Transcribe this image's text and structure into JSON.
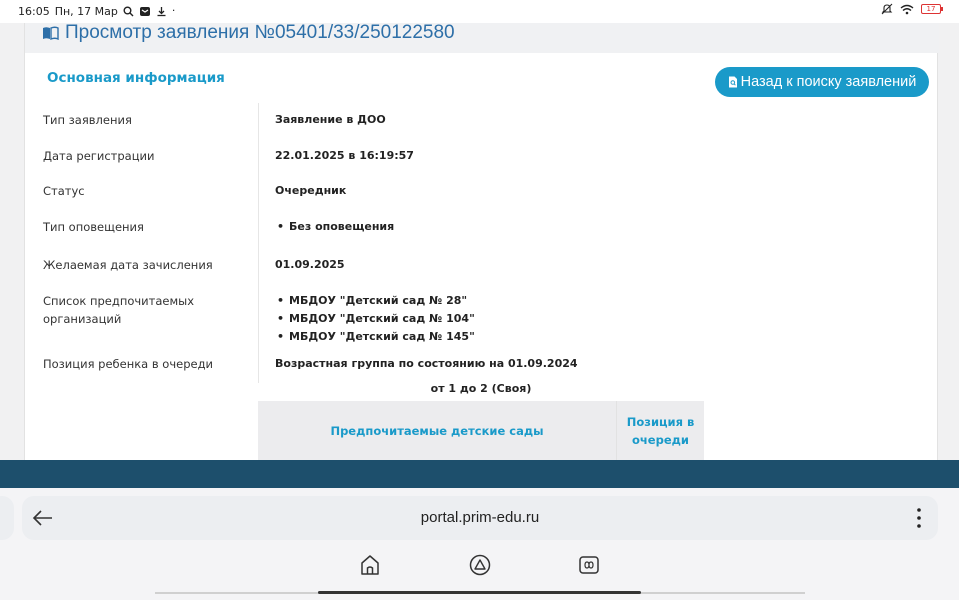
{
  "status_bar": {
    "time": "16:05",
    "date": "Пн, 17 Мар",
    "battery": "17"
  },
  "header": {
    "title": "Просмотр заявления №05401/33/250122580"
  },
  "section": {
    "title": "Основная информация",
    "back_button_label": "Назад к поиску заявлений"
  },
  "info": {
    "type_label": "Тип заявления",
    "type_value": "Заявление в ДОО",
    "reg_date_label": "Дата регистрации",
    "reg_date_value": "22.01.2025 в 16:19:57",
    "status_label": "Статус",
    "status_value": "Очередник",
    "notify_label": "Тип оповещения",
    "notify_items": [
      "Без оповещения"
    ],
    "enroll_date_label": "Желаемая дата зачисления",
    "enroll_date_value": "01.09.2025",
    "orgs_label": "Список предпочитаемых организаций",
    "orgs_items": [
      "МБДОУ \"Детский сад № 28\"",
      "МБДОУ \"Детский сад № 104\"",
      "МБДОУ \"Детский сад № 145\""
    ],
    "position_label": "Позиция ребенка в очереди",
    "position_value": "Возрастная группа по состоянию на 01.09.2024",
    "age_range": "от 1 до 2 (Своя)"
  },
  "queue_table": {
    "columns": [
      "Предпочитаемые детские сады",
      "Позиция в очереди"
    ]
  },
  "browser": {
    "url": "portal.prim-edu.ru"
  },
  "colors": {
    "accent": "#1a9ac9",
    "title_blue": "#2d6fa8",
    "band": "#1d4f6c"
  }
}
